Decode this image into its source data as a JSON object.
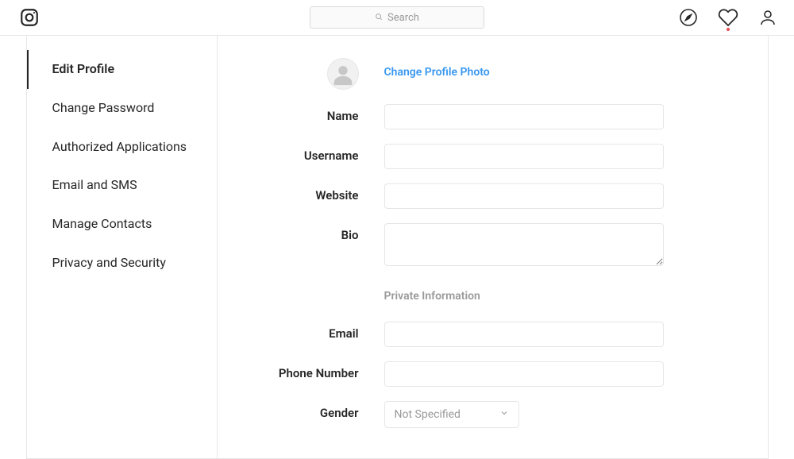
{
  "header": {
    "search_placeholder": "Search"
  },
  "sidebar": {
    "items": [
      {
        "label": "Edit Profile",
        "active": true
      },
      {
        "label": "Change Password",
        "active": false
      },
      {
        "label": "Authorized Applications",
        "active": false
      },
      {
        "label": "Email and SMS",
        "active": false
      },
      {
        "label": "Manage Contacts",
        "active": false
      },
      {
        "label": "Privacy and Security",
        "active": false
      }
    ]
  },
  "form": {
    "change_photo_label": "Change Profile Photo",
    "labels": {
      "name": "Name",
      "username": "Username",
      "website": "Website",
      "bio": "Bio",
      "email": "Email",
      "phone": "Phone Number",
      "gender": "Gender"
    },
    "values": {
      "name": "",
      "username": "",
      "website": "",
      "bio": "",
      "email": "",
      "phone": "",
      "gender": "Not Specified"
    },
    "private_heading": "Private Information"
  }
}
